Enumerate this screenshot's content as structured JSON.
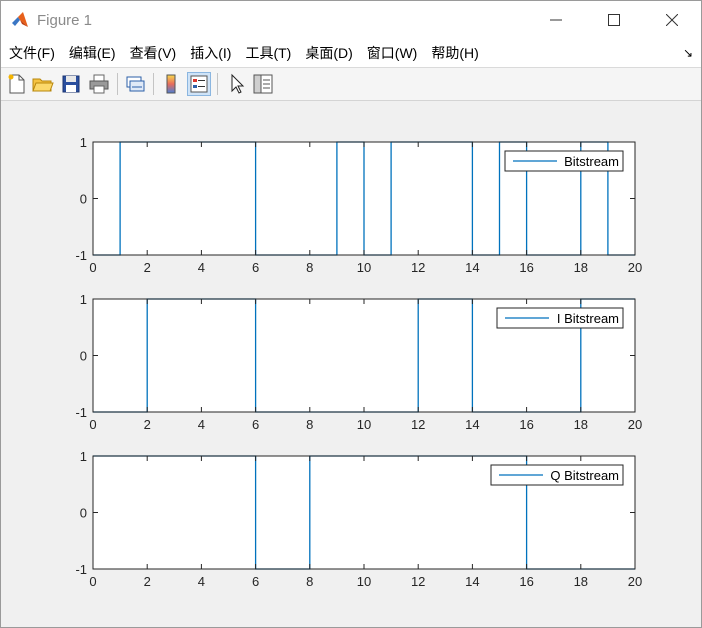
{
  "window": {
    "title": "Figure 1"
  },
  "menu": [
    "文件(F)",
    "编辑(E)",
    "查看(V)",
    "插入(I)",
    "工具(T)",
    "桌面(D)",
    "窗口(W)",
    "帮助(H)"
  ],
  "chart_data": [
    {
      "type": "line",
      "step": true,
      "x": [
        0,
        1,
        2,
        3,
        4,
        5,
        6,
        7,
        8,
        9,
        10,
        11,
        12,
        13,
        14,
        15,
        16,
        17,
        18,
        19,
        20
      ],
      "series": [
        {
          "name": "Bitstream",
          "values": [
            -1,
            1,
            1,
            1,
            1,
            1,
            -1,
            -1,
            -1,
            1,
            -1,
            1,
            1,
            1,
            -1,
            1,
            -1,
            -1,
            1,
            -1,
            -1
          ]
        }
      ],
      "xlim": [
        0,
        20
      ],
      "ylim": [
        -1,
        1
      ],
      "xticks": [
        0,
        2,
        4,
        6,
        8,
        10,
        12,
        14,
        16,
        18,
        20
      ],
      "yticks": [
        -1,
        0,
        1
      ],
      "legend": "top-right",
      "color": "#0072bd"
    },
    {
      "type": "line",
      "step": true,
      "x": [
        0,
        2,
        4,
        6,
        8,
        10,
        12,
        14,
        16,
        18,
        20
      ],
      "series": [
        {
          "name": "I Bitstream",
          "values": [
            -1,
            1,
            1,
            -1,
            -1,
            -1,
            1,
            -1,
            -1,
            1,
            1
          ]
        }
      ],
      "xlim": [
        0,
        20
      ],
      "ylim": [
        -1,
        1
      ],
      "xticks": [
        0,
        2,
        4,
        6,
        8,
        10,
        12,
        14,
        16,
        18,
        20
      ],
      "yticks": [
        -1,
        0,
        1
      ],
      "legend": "top-right",
      "color": "#0072bd"
    },
    {
      "type": "line",
      "step": true,
      "x": [
        0,
        2,
        4,
        6,
        8,
        10,
        12,
        14,
        16,
        18,
        20
      ],
      "series": [
        {
          "name": "Q Bitstream",
          "values": [
            1,
            1,
            1,
            -1,
            1,
            1,
            1,
            1,
            -1,
            -1,
            -1
          ]
        }
      ],
      "xlim": [
        0,
        20
      ],
      "ylim": [
        -1,
        1
      ],
      "xticks": [
        0,
        2,
        4,
        6,
        8,
        10,
        12,
        14,
        16,
        18,
        20
      ],
      "yticks": [
        -1,
        0,
        1
      ],
      "legend": "top-right",
      "color": "#0072bd"
    }
  ]
}
